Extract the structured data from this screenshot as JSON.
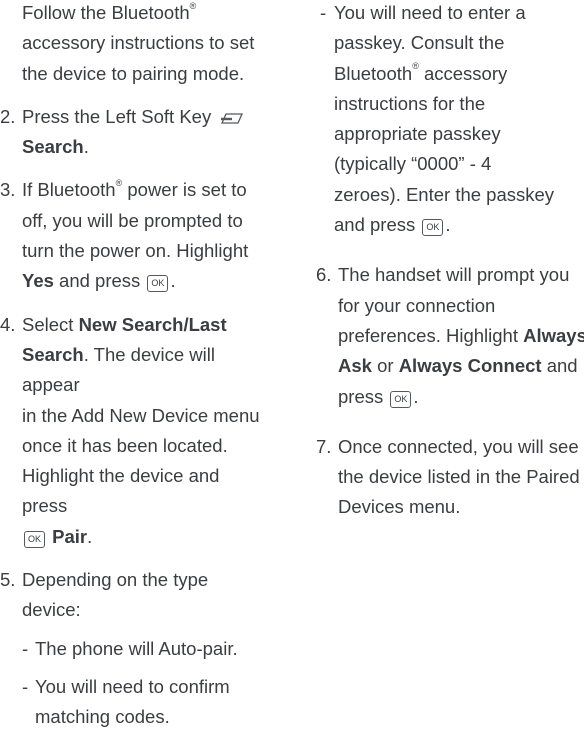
{
  "left": {
    "intro": {
      "line1": "Follow the Bluetooth",
      "reg": "®",
      "line2": "accessory instructions to set",
      "line3": "the device to pairing mode."
    },
    "step2": {
      "num": "2.",
      "a": "Press the Left Soft Key",
      "b_bold": "Search",
      "b_tail": "."
    },
    "step3": {
      "num": "3.",
      "a1": "If Bluetooth",
      "a2": " power is set to",
      "b": "off, you will be prompted to",
      "c": "turn the power on. Highlight",
      "d_bold": "Yes",
      "d_mid": " and press",
      "d_tail": "."
    },
    "step4": {
      "num": "4.",
      "a1": "Select ",
      "a_bold": "New Search/Last",
      "b_bold": "Search",
      "b_tail": ". The device will appear",
      "c": "in the Add New Device menu",
      "d": "once it has been located.",
      "e": "Highlight the device and press",
      "f_bold": "Pair",
      "f_tail": "."
    },
    "step5": {
      "num": "5.",
      "a": "Depending on the type",
      "b": "device:",
      "sub1": "The phone will Auto-pair.",
      "sub2a": "You will need to confirm",
      "sub2b": "matching codes."
    }
  },
  "right": {
    "sub3": {
      "a": "You will need to enter a",
      "b": "passkey. Consult the",
      "c1": "Bluetooth",
      "c2": " accessory",
      "d": "instructions for the",
      "e": "appropriate passkey",
      "f": "(typically “0000” - 4",
      "g": "zeroes). Enter the passkey",
      "h": "and press",
      "h_tail": "."
    },
    "step6": {
      "num": "6.",
      "a": "The handset will prompt you",
      "b": "for your connection",
      "c1": "preferences. Highlight ",
      "c_bold": "Always",
      "d_bold1": "Ask",
      "d_mid": " or ",
      "d_bold2": "Always Connect",
      "d_tail": " and",
      "e": "press",
      "e_tail": "."
    },
    "step7": {
      "num": "7.",
      "a": "Once connected, you will see",
      "b": "the device listed in the Paired",
      "c": "Devices menu."
    }
  },
  "icons": {
    "ok_label": "OK",
    "dash": "-"
  },
  "colors": {
    "text": "#3b3d42",
    "background": "#ffffff"
  }
}
